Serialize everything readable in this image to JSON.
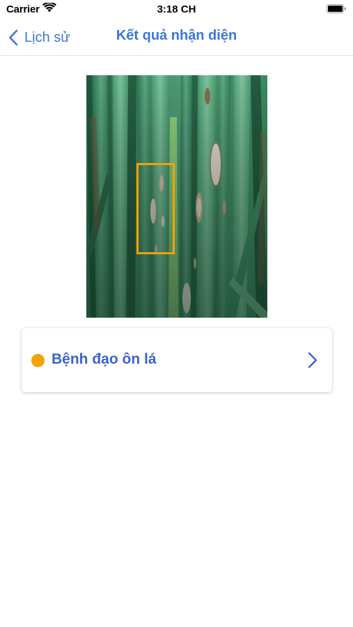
{
  "status_bar": {
    "carrier": "Carrier",
    "time": "3:18 CH"
  },
  "nav": {
    "back_label": "Lịch sử",
    "title": "Kết quả nhận diện"
  },
  "result": {
    "label": "Bệnh đạo ôn lá",
    "indicator_color": "#f4a10a"
  },
  "colors": {
    "accent": "#3d77d6",
    "detection_box": "#f4a10a"
  },
  "icons": {
    "back": "chevron-left-icon",
    "result_open": "chevron-right-icon",
    "wifi": "wifi-icon",
    "battery": "battery-icon"
  }
}
